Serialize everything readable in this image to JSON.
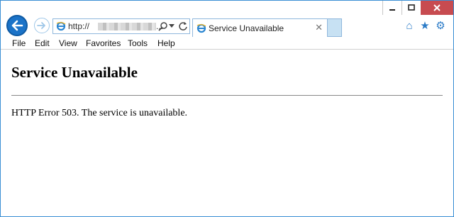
{
  "browser": {
    "address_bar": {
      "url": "http://",
      "ellipsis": "..."
    },
    "tab": {
      "title": "Service Unavailable"
    },
    "menu": [
      "File",
      "Edit",
      "View",
      "Favorites",
      "Tools",
      "Help"
    ],
    "icons": {
      "back": "back-arrow-icon",
      "forward": "forward-arrow-icon",
      "search": "search-icon",
      "dropdown": "chevron-down-icon",
      "refresh": "refresh-icon",
      "home": "home-icon",
      "favorites": "star-icon",
      "tools": "gear-icon",
      "page": "ie-page-icon"
    },
    "colors": {
      "accent": "#1b73c8",
      "close_button": "#c74b50"
    }
  },
  "page": {
    "heading": "Service Unavailable",
    "message": "HTTP Error 503. The service is unavailable."
  }
}
